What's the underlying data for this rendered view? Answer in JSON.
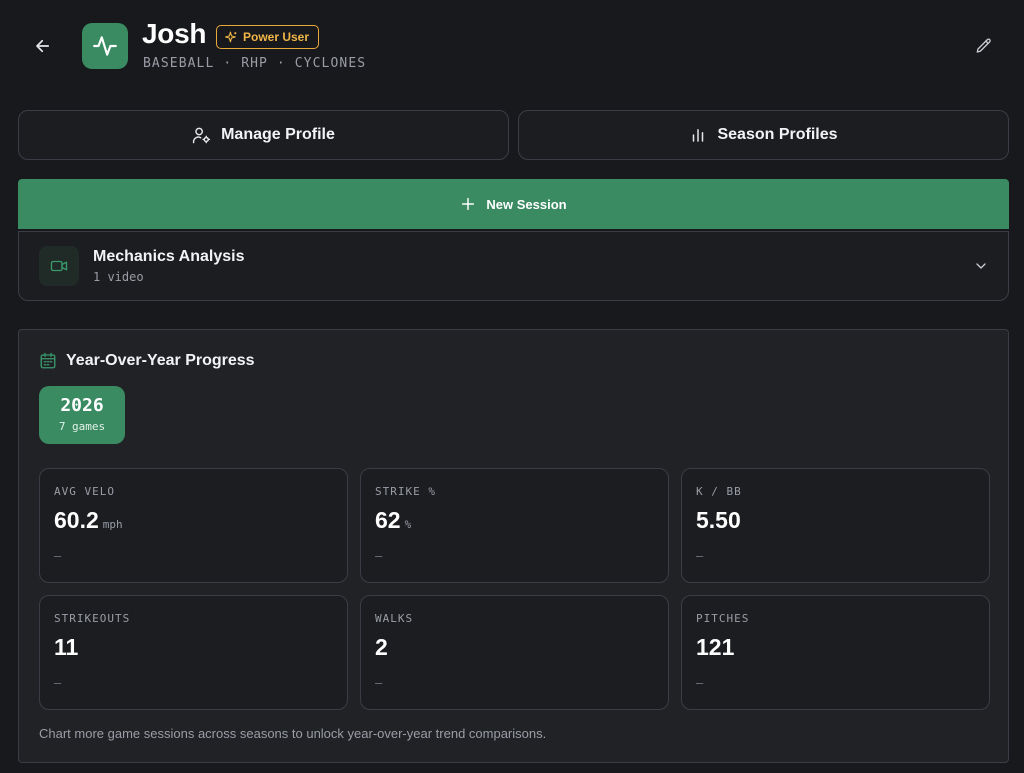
{
  "header": {
    "name": "Josh",
    "badge": "Power User",
    "subtitle": "BASEBALL · RHP · CYCLONES"
  },
  "actions": {
    "manage_profile": "Manage Profile",
    "season_profiles": "Season Profiles",
    "new_session": "New Session"
  },
  "mechanics": {
    "title": "Mechanics Analysis",
    "subtitle": "1 video"
  },
  "yoy": {
    "title": "Year-Over-Year Progress",
    "year": "2026",
    "year_sub": "7 games",
    "stats": [
      {
        "label": "AVG VELO",
        "value": "60.2",
        "unit": "mph",
        "trend": "—"
      },
      {
        "label": "STRIKE %",
        "value": "62",
        "unit": "%",
        "trend": "—"
      },
      {
        "label": "K / BB",
        "value": "5.50",
        "unit": "",
        "trend": "—"
      },
      {
        "label": "STRIKEOUTS",
        "value": "11",
        "unit": "",
        "trend": "—"
      },
      {
        "label": "WALKS",
        "value": "2",
        "unit": "",
        "trend": "—"
      },
      {
        "label": "PITCHES",
        "value": "121",
        "unit": "",
        "trend": "—"
      }
    ],
    "footnote": "Chart more game sessions across seasons to unlock year-over-year trend comparisons."
  },
  "colors": {
    "accent": "#3a8a62",
    "badge": "#f0b648",
    "background": "#18191c"
  },
  "icons": {
    "back": "arrow-left-icon",
    "app": "activity-pulse-icon",
    "badge": "sparkles-icon",
    "edit": "pencil-icon",
    "manage": "user-cog-icon",
    "season": "bar-chart-icon",
    "new": "plus-icon",
    "mechanics": "video-camera-icon",
    "expand": "chevron-down-icon",
    "calendar": "calendar-icon"
  }
}
